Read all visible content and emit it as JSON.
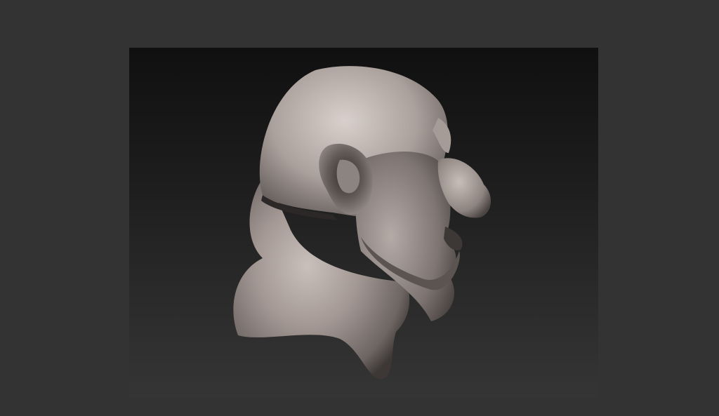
{
  "app": {
    "colors": {
      "outer_background": "#333333",
      "viewport_top": "#101010",
      "viewport_bottom": "#353535",
      "model_clay": "#8c8480",
      "model_shadow": "#3a3533"
    }
  },
  "viewport": {
    "content": "sculpt-model"
  }
}
